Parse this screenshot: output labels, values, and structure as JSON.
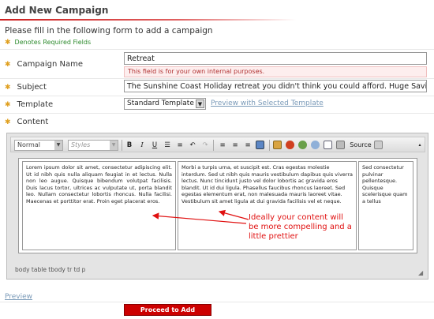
{
  "page": {
    "title": "Add New Campaign",
    "intro": "Please fill in the following form to add a campaign",
    "required_note": "Denotes Required Fields"
  },
  "fields": {
    "campaign_name": {
      "label": "Campaign Name",
      "value": "Retreat",
      "hint": "This field is for your own internal purposes."
    },
    "subject": {
      "label": "Subject",
      "value": "The Sunshine Coast Holiday retreat you didn't think you could afford. Huge Savings!"
    },
    "template": {
      "label": "Template",
      "selected": "Standard Template",
      "preview_link": "Preview with Selected Template"
    },
    "content": {
      "label": "Content"
    }
  },
  "editor": {
    "toolbar": {
      "format": "Normal",
      "styles": "Styles",
      "bold": "B",
      "italic": "I",
      "underline": "U",
      "source": "Source"
    },
    "cells": [
      "Lorem ipsum dolor sit amet, consectetur adipiscing elit. Ut id nibh quis nulla aliquam feugiat in et lectus. Nulla non leo augue. Quisque bibendum volutpat facilisis. Duis lacus tortor, ultrices ac vulputate ut, porta blandit leo. Nullam consectetur lobortis rhoncus. Nulla facilisi. Maecenas et porttitor erat. Proin eget placerat eros.",
      "Morbi a turpis urna, et suscipit est. Cras egestas molestie interdum. Sed ut nibh quis mauris vestibulum dapibus quis viverra lectus. Nunc tincidunt justo vel dolor lobortis ac gravida eros blandit. Ut id dui ligula. Phasellus faucibus rhoncus laoreet. Sed egestas elementum erat, non malesuada mauris laoreet vitae. Vestibulum sit amet ligula at dui gravida facilisis vel et neque.",
      "Sed consectetur pulvinar pellentesque. Quisque scelerisque quam a tellus"
    ],
    "annotation": "Ideally your content will be more compelling and a little prettier",
    "statusbar": "body table tbody tr td p"
  },
  "footer": {
    "preview": "Preview",
    "submit": "Proceed to Add Contacts >"
  },
  "colors": {
    "accent_red": "#cc0000",
    "required_star": "#e0a020",
    "link_blue": "#7a9ab8"
  }
}
